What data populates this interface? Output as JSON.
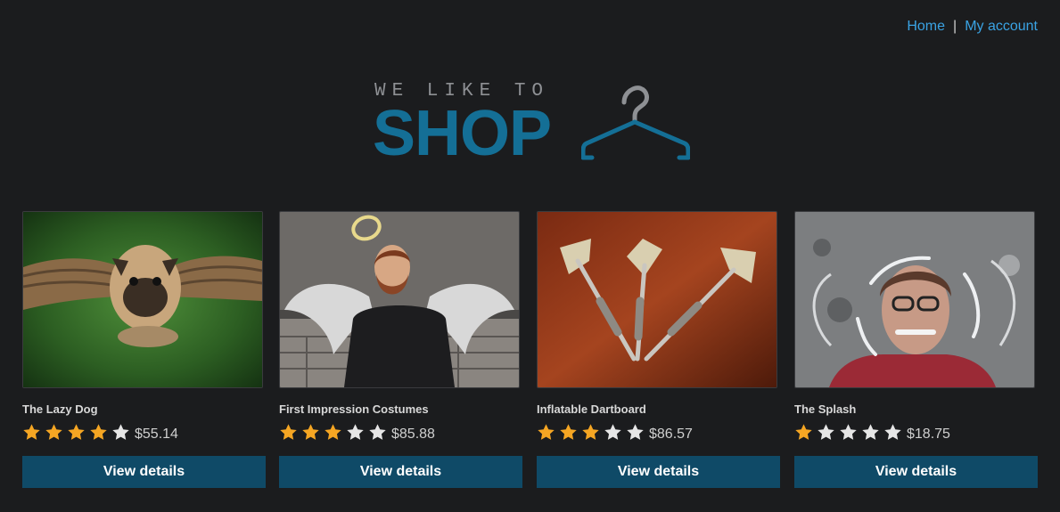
{
  "nav": {
    "home_label": "Home",
    "separator": "|",
    "account_label": "My account"
  },
  "logo": {
    "tagline": "WE LIKE TO",
    "brand": "SHOP"
  },
  "colors": {
    "background": "#1b1c1e",
    "accent": "#146f96",
    "button": "#0f4a67",
    "link": "#3aa3e4",
    "star_filled": "#f5a623",
    "star_empty": "#e6e6e6"
  },
  "products": [
    {
      "name": "The Lazy Dog",
      "rating": 4,
      "max_rating": 5,
      "price": "$55.14",
      "button_label": "View details",
      "image": "flying-pug-image"
    },
    {
      "name": "First Impression Costumes",
      "rating": 3,
      "max_rating": 5,
      "price": "$85.88",
      "button_label": "View details",
      "image": "angel-man-image"
    },
    {
      "name": "Inflatable Dartboard",
      "rating": 3,
      "max_rating": 5,
      "price": "$86.57",
      "button_label": "View details",
      "image": "darts-image"
    },
    {
      "name": "The Splash",
      "rating": 1,
      "max_rating": 5,
      "price": "$18.75",
      "button_label": "View details",
      "image": "water-splash-image"
    }
  ]
}
